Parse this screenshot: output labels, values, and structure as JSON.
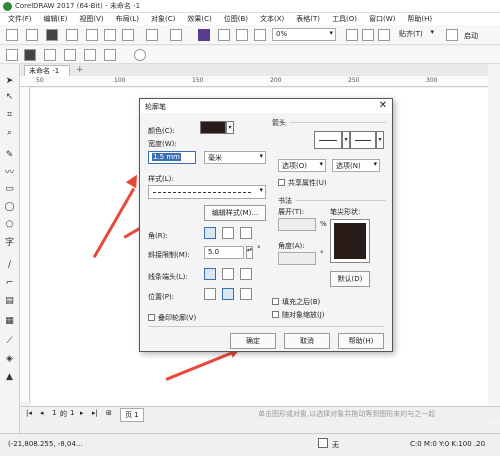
{
  "window": {
    "title": "CorelDRAW 2017 (64-Bit) - 未命名 -1"
  },
  "menu": [
    "文件(F)",
    "编辑(E)",
    "视图(V)",
    "布局(L)",
    "对象(C)",
    "效果(C)",
    "位图(B)",
    "文本(X)",
    "表格(T)",
    "工具(O)",
    "窗口(W)",
    "帮助(H)"
  ],
  "toolbar": {
    "zoom_value": "0%",
    "snap_label": "贴齐(T)",
    "launch_label": "启动"
  },
  "tab": {
    "doc_label": "未命名 -1"
  },
  "ruler": {
    "ticks": [
      "50",
      "100",
      "150",
      "200",
      "250",
      "300"
    ]
  },
  "pages": {
    "current": "1",
    "of": "的",
    "total": "1",
    "page_tab": "页 1"
  },
  "status": {
    "coords": "(-21,808.255, -8,04...",
    "fill_label": "无",
    "color_text": "C:0 M:0 Y:0 K:100 .20",
    "hint": "单击图形或对象,以选择对象并拖动等到图形来的与之一起"
  },
  "dialog": {
    "title": "轮廓笔",
    "color_label": "颜色(C):",
    "color_value": "#2a1c18",
    "width_label": "宽度(W):",
    "width_value": "1.5 mm",
    "unit_value": "毫米",
    "style_label": "样式(L):",
    "edit_style_button": "编辑样式(M)...",
    "corner_label": "角(R):",
    "miter_label": "斜接限制(M):",
    "miter_value": "5.0",
    "degree": "°",
    "linecaps_label": "线条端头(L):",
    "position_label": "位置(P):",
    "overprint_label": "叠印轮廓(V)",
    "arrows_group": "箭头",
    "options_left": "选项(O)",
    "options_right": "选项(N)",
    "share_attr_label": "共享属性(U)",
    "calligraphy_group": "书法",
    "stretch_label": "展开(T):",
    "percent": "%",
    "nib_shape_label": "笔尖形状:",
    "angle_label": "角度(A):",
    "default_button": "默认(D)",
    "behind_fill_label": "填充之后(B)",
    "scale_label": "随对象缩放(J)",
    "ok_button": "确定",
    "cancel_button": "取消",
    "help_button": "帮助(H)",
    "nib_color": "#2a1c18"
  },
  "colors": {
    "arrow": "#e84a3a",
    "selection": "#3a6fb5"
  }
}
